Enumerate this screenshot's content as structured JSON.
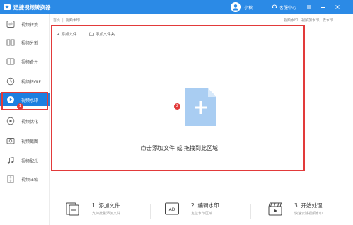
{
  "titlebar": {
    "app_title": "迅捷视频转换器",
    "username": "小秋",
    "service": "客服中心"
  },
  "sidebar": {
    "items": [
      {
        "label": "视频转换",
        "icon": "convert-icon"
      },
      {
        "label": "视频分割",
        "icon": "split-icon"
      },
      {
        "label": "视频合并",
        "icon": "merge-icon"
      },
      {
        "label": "视频转GIF",
        "icon": "gif-icon"
      },
      {
        "label": "视频水印",
        "icon": "watermark-icon",
        "active": true
      },
      {
        "label": "视频优化",
        "icon": "optimize-icon"
      },
      {
        "label": "视频截图",
        "icon": "screenshot-icon"
      },
      {
        "label": "视频配乐",
        "icon": "music-icon"
      },
      {
        "label": "视频压缩",
        "icon": "compress-icon"
      }
    ],
    "badge": "1"
  },
  "breadcrumb": {
    "home": "首页",
    "separator": "|",
    "current": "视频水印"
  },
  "right_note": "视频水印：视频加水印，去水印",
  "dropzone": {
    "add_file": "添加文件",
    "add_folder": "添加文件夹",
    "hint": "点击添加文件 或 拖拽到此区域",
    "badge": "2"
  },
  "steps": [
    {
      "title": "1. 添加文件",
      "desc": "支持批量添加文件"
    },
    {
      "title": "2. 编辑水印",
      "desc": "定位水印区域"
    },
    {
      "title": "3. 开始处理",
      "desc": "快速去除视频水印"
    }
  ],
  "colors": {
    "accent": "#2b8ae6",
    "active": "#1c7fe0",
    "highlight": "#e23a3a",
    "drop_icon": "#a9cdf2"
  }
}
